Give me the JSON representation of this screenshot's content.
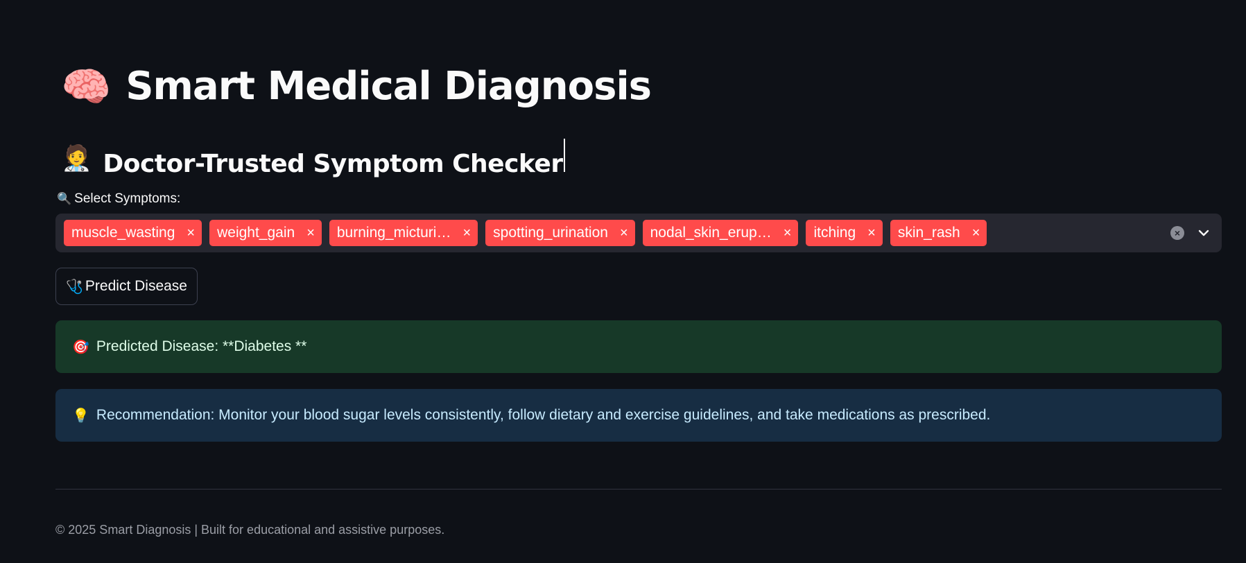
{
  "header": {
    "title_emoji": "🧠",
    "title": "Smart Medical Diagnosis",
    "subtitle_emoji": "🧑‍⚕️",
    "subtitle": "Doctor-Trusted Symptom Checker"
  },
  "symptoms": {
    "label_emoji": "🔍",
    "label": "Select Symptoms:",
    "selected": [
      "muscle_wasting",
      "weight_gain",
      "burning_micturi…",
      "spotting_urination",
      "nodal_skin_erup…",
      "itching",
      "skin_rash"
    ],
    "remove_glyph": "×",
    "clear_glyph": "×",
    "chevron_glyph": "⌄"
  },
  "predict_button": {
    "emoji": "🩺",
    "label": "Predict Disease"
  },
  "result": {
    "emoji": "🎯",
    "text": "Predicted Disease: **Diabetes **"
  },
  "recommendation": {
    "emoji": "💡",
    "text": "Recommendation: Monitor your blood sugar levels consistently, follow dietary and exercise guidelines, and take medications as prescribed."
  },
  "footer": {
    "text": "© 2025 Smart Diagnosis | Built for educational and assistive purposes."
  },
  "colors": {
    "background": "#0e1117",
    "tag": "#ff4b4b",
    "success_bg": "#173928",
    "info_bg": "#172d43",
    "input_bg": "#262730"
  }
}
